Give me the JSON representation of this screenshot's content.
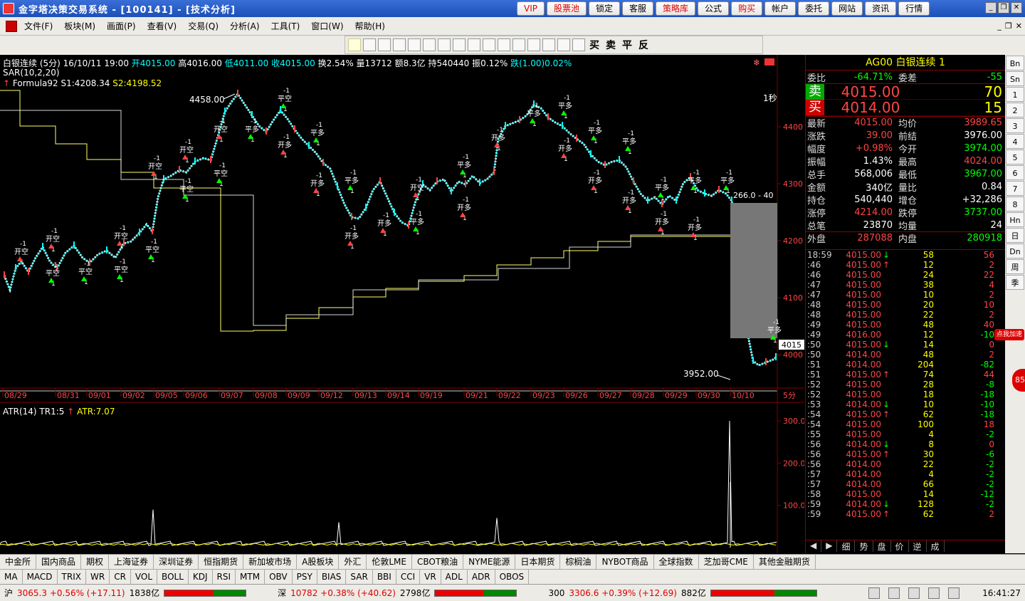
{
  "window": {
    "title": "金字塔决策交易系统 - [100141] - [技术分析]",
    "top_buttons": [
      {
        "label": "VIP",
        "red": true
      },
      {
        "label": "股票池",
        "red": true
      },
      {
        "label": "锁定",
        "red": false
      },
      {
        "label": "客服",
        "red": false
      },
      {
        "label": "策略库",
        "red": true
      },
      {
        "label": "公式",
        "red": false
      },
      {
        "label": "购买",
        "red": true
      },
      {
        "label": "帐户",
        "red": false
      },
      {
        "label": "委托",
        "red": false
      },
      {
        "label": "网站",
        "red": false
      },
      {
        "label": "资讯",
        "red": false
      },
      {
        "label": "行情",
        "red": false
      }
    ]
  },
  "menu": [
    "文件(F)",
    "板块(M)",
    "画面(P)",
    "查看(V)",
    "交易(Q)",
    "分析(A)",
    "工具(T)",
    "窗口(W)",
    "帮助(H)"
  ],
  "toolbar": {
    "text_tools": [
      "买",
      "卖",
      "平",
      "反"
    ]
  },
  "chart": {
    "header1": {
      "name": "白银连续 (5分)",
      "date": "16/10/11 19:00",
      "open": "开4015.00",
      "high": "高4016.00",
      "low": "低4011.00",
      "close": "收4015.00",
      "turnover": "换2.54%",
      "volume": "量13712",
      "amount": "额8.3亿",
      "hold": "持540440",
      "amp": "振0.12%",
      "chg": "跌(1.00)0.02%"
    },
    "header2": "SAR(10,2,20)",
    "header3": {
      "formula": "Formula92",
      "s1": "S1:4208.34",
      "s2": "S2:4198.52"
    },
    "high_label": "4458.00",
    "low_label": "3952.00",
    "box_label": "266.0 - 40",
    "period_label": "1秒",
    "price_tag": "4015",
    "y_ticks": [
      "4400",
      "4300",
      "4200",
      "4100",
      "4000"
    ],
    "dates": [
      "08/29",
      "08/31",
      "09/01",
      "09/02",
      "09/05",
      "09/06",
      "09/07",
      "09/08",
      "09/09",
      "09/12",
      "09/13",
      "09/14",
      "09/19",
      "09/21",
      "09/22",
      "09/23",
      "09/26",
      "09/27",
      "09/28",
      "09/29",
      "09/30",
      "10/10"
    ],
    "period_tag": "5分",
    "atr_header": {
      "name": "ATR(14)",
      "tr": "TR1:5",
      "atr": "ATR:7.07"
    },
    "atr_ticks": [
      "300.0",
      "200.0",
      "100.0"
    ],
    "signal_labels": [
      "开空",
      "平空",
      "开多",
      "平多",
      "-1",
      "1"
    ]
  },
  "quote": {
    "title": "AG00  白银连续  1",
    "row_wb": {
      "l1": "委比",
      "v1": "-64.71%",
      "l2": "委差",
      "v2": "-55"
    },
    "sell": {
      "tag": "卖",
      "price": "4015.00",
      "vol": "70"
    },
    "buy": {
      "tag": "买",
      "price": "4014.00",
      "vol": "15"
    },
    "rows": [
      {
        "l1": "最新",
        "v1": "4015.00",
        "c1": "up",
        "l2": "均价",
        "v2": "3989.65",
        "c2": "up"
      },
      {
        "l1": "涨跌",
        "v1": "39.00",
        "c1": "up",
        "l2": "前结",
        "v2": "3976.00",
        "c2": "wh"
      },
      {
        "l1": "幅度",
        "v1": "+0.98%",
        "c1": "up",
        "l2": "今开",
        "v2": "3974.00",
        "c2": "dn"
      },
      {
        "l1": "振幅",
        "v1": "1.43%",
        "c1": "wh",
        "l2": "最高",
        "v2": "4024.00",
        "c2": "up"
      },
      {
        "l1": "总手",
        "v1": "568,006",
        "c1": "wh",
        "l2": "最低",
        "v2": "3967.00",
        "c2": "dn"
      },
      {
        "l1": "金额",
        "v1": "340亿",
        "c1": "wh",
        "l2": "量比",
        "v2": "0.84",
        "c2": "wh"
      },
      {
        "l1": "持仓",
        "v1": "540,440",
        "c1": "wh",
        "l2": "增仓",
        "v2": "+32,286",
        "c2": "wh"
      },
      {
        "l1": "涨停",
        "v1": "4214.00",
        "c1": "up",
        "l2": "跌停",
        "v2": "3737.00",
        "c2": "dn"
      },
      {
        "l1": "总笔",
        "v1": "23870",
        "c1": "wh",
        "l2": "均量",
        "v2": "24",
        "c2": "wh"
      }
    ],
    "outer": {
      "l1": "外盘",
      "v1": "287088",
      "l2": "内盘",
      "v2": "280918"
    },
    "ticks": [
      {
        "t": "18:59",
        "p": "4015.00",
        "a": "↓",
        "v": "58",
        "d": "56"
      },
      {
        "t": ":46",
        "p": "4015.00",
        "a": "↑",
        "v": "12",
        "d": "2"
      },
      {
        "t": ":46",
        "p": "4015.00",
        "a": "",
        "v": "24",
        "d": "22"
      },
      {
        "t": ":47",
        "p": "4015.00",
        "a": "",
        "v": "38",
        "d": "4"
      },
      {
        "t": ":47",
        "p": "4015.00",
        "a": "",
        "v": "10",
        "d": "2"
      },
      {
        "t": ":48",
        "p": "4015.00",
        "a": "",
        "v": "20",
        "d": "10"
      },
      {
        "t": ":48",
        "p": "4015.00",
        "a": "",
        "v": "22",
        "d": "2"
      },
      {
        "t": ":49",
        "p": "4015.00",
        "a": "",
        "v": "48",
        "d": "40"
      },
      {
        "t": ":49",
        "p": "4016.00",
        "a": "",
        "v": "12",
        "d": "-10"
      },
      {
        "t": ":50",
        "p": "4015.00",
        "a": "↓",
        "v": "14",
        "d": "0"
      },
      {
        "t": ":50",
        "p": "4014.00",
        "a": "",
        "v": "48",
        "d": "2"
      },
      {
        "t": ":51",
        "p": "4014.00",
        "a": "",
        "v": "204",
        "d": "-82"
      },
      {
        "t": ":51",
        "p": "4015.00",
        "a": "↑",
        "v": "74",
        "d": "44"
      },
      {
        "t": ":52",
        "p": "4015.00",
        "a": "",
        "v": "28",
        "d": "-8"
      },
      {
        "t": ":52",
        "p": "4015.00",
        "a": "",
        "v": "18",
        "d": "-18"
      },
      {
        "t": ":53",
        "p": "4014.00",
        "a": "↓",
        "v": "10",
        "d": "-10"
      },
      {
        "t": ":54",
        "p": "4015.00",
        "a": "↑",
        "v": "62",
        "d": "-18"
      },
      {
        "t": ":54",
        "p": "4015.00",
        "a": "",
        "v": "100",
        "d": "18"
      },
      {
        "t": ":55",
        "p": "4015.00",
        "a": "",
        "v": "4",
        "d": "-2"
      },
      {
        "t": ":56",
        "p": "4014.00",
        "a": "↓",
        "v": "8",
        "d": "0"
      },
      {
        "t": ":56",
        "p": "4015.00",
        "a": "↑",
        "v": "30",
        "d": "-6"
      },
      {
        "t": ":56",
        "p": "4014.00",
        "a": "",
        "v": "22",
        "d": "-2"
      },
      {
        "t": ":57",
        "p": "4014.00",
        "a": "",
        "v": "4",
        "d": "-2"
      },
      {
        "t": ":57",
        "p": "4014.00",
        "a": "",
        "v": "66",
        "d": "-2"
      },
      {
        "t": ":58",
        "p": "4015.00",
        "a": "",
        "v": "14",
        "d": "-12"
      },
      {
        "t": ":59",
        "p": "4014.00",
        "a": "↓",
        "v": "128",
        "d": "-2"
      },
      {
        "t": ":59",
        "p": "4015.00",
        "a": "↑",
        "v": "62",
        "d": "2"
      }
    ],
    "tabs": [
      "细",
      "势",
      "盘",
      "价",
      "逆",
      "成"
    ]
  },
  "side_strip": [
    "Bn",
    "Sn",
    "1",
    "2",
    "3",
    "4",
    "5",
    "6",
    "7",
    "8",
    "Hn",
    "日",
    "Dn",
    "周",
    "季"
  ],
  "badge": "点我加速",
  "circle_badge": "85",
  "market_tabs": [
    "中金所",
    "国内商品",
    "期权",
    "上海证券",
    "深圳证券",
    "恒指期货",
    "新加坡市场",
    "A股板块",
    "外汇",
    "伦敦LME",
    "CBOT粮油",
    "NYME能源",
    "日本期货",
    "棕榈油",
    "NYBOT商品",
    "全球指数",
    "芝加哥CME",
    "其他金融期货"
  ],
  "indicator_tabs": [
    "MA",
    "MACD",
    "TRIX",
    "WR",
    "CR",
    "VOL",
    "BOLL",
    "KDJ",
    "RSI",
    "MTM",
    "OBV",
    "PSY",
    "BIAS",
    "SAR",
    "BBI",
    "CCI",
    "VR",
    "ADL",
    "ADR",
    "OBOS"
  ],
  "status": {
    "sh": {
      "label": "沪",
      "val": "3065.3 +0.56% (+17.11)",
      "vol": "1838亿"
    },
    "sz": {
      "label": "深",
      "val": "10782 +0.38% (+40.62)",
      "vol": "2798亿"
    },
    "hs": {
      "label": "300",
      "val": "3306.6 +0.39% (+12.69)",
      "vol": "882亿"
    },
    "clock": "16:41:27"
  },
  "colors": {
    "up": "#ff4444",
    "down": "#00ff00",
    "grid": "#800000",
    "sar": "#ffffff",
    "stop": "#ffff66"
  }
}
